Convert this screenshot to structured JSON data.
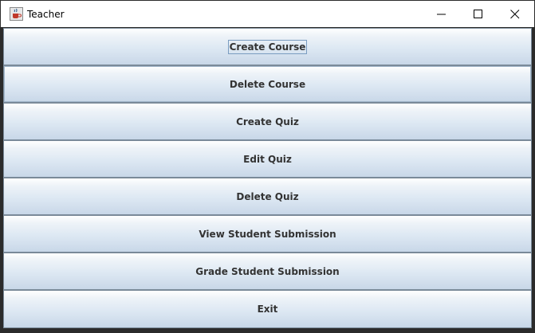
{
  "window": {
    "title": "Teacher",
    "app_icon": "java-cup-icon",
    "controls": [
      "minimize-icon",
      "maximize-icon",
      "close-icon"
    ]
  },
  "menu": {
    "buttons": [
      {
        "label": "Create Course",
        "focused": true
      },
      {
        "label": "Delete Course",
        "selected": true
      },
      {
        "label": "Create Quiz"
      },
      {
        "label": "Edit Quiz"
      },
      {
        "label": "Delete Quiz"
      },
      {
        "label": "View Student Submission"
      },
      {
        "label": "Grade Student Submission"
      },
      {
        "label": "Exit"
      }
    ]
  },
  "colors": {
    "button_gradient_top": "#ffffff",
    "button_gradient_bottom": "#c8d7e8",
    "button_border": "#7a8a99",
    "button_text": "#333333",
    "focus_outline": "#7a9cc0"
  }
}
